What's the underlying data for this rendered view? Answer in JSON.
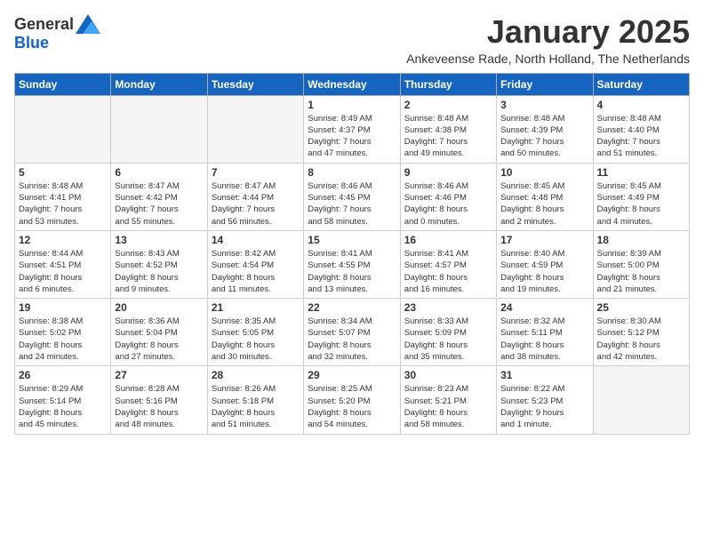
{
  "logo": {
    "general": "General",
    "blue": "Blue"
  },
  "header": {
    "month_year": "January 2025",
    "location": "Ankeveense Rade, North Holland, The Netherlands"
  },
  "weekdays": [
    "Sunday",
    "Monday",
    "Tuesday",
    "Wednesday",
    "Thursday",
    "Friday",
    "Saturday"
  ],
  "weeks": [
    [
      {
        "day": "",
        "info": ""
      },
      {
        "day": "",
        "info": ""
      },
      {
        "day": "",
        "info": ""
      },
      {
        "day": "1",
        "info": "Sunrise: 8:49 AM\nSunset: 4:37 PM\nDaylight: 7 hours\nand 47 minutes."
      },
      {
        "day": "2",
        "info": "Sunrise: 8:48 AM\nSunset: 4:38 PM\nDaylight: 7 hours\nand 49 minutes."
      },
      {
        "day": "3",
        "info": "Sunrise: 8:48 AM\nSunset: 4:39 PM\nDaylight: 7 hours\nand 50 minutes."
      },
      {
        "day": "4",
        "info": "Sunrise: 8:48 AM\nSunset: 4:40 PM\nDaylight: 7 hours\nand 51 minutes."
      }
    ],
    [
      {
        "day": "5",
        "info": "Sunrise: 8:48 AM\nSunset: 4:41 PM\nDaylight: 7 hours\nand 53 minutes."
      },
      {
        "day": "6",
        "info": "Sunrise: 8:47 AM\nSunset: 4:42 PM\nDaylight: 7 hours\nand 55 minutes."
      },
      {
        "day": "7",
        "info": "Sunrise: 8:47 AM\nSunset: 4:44 PM\nDaylight: 7 hours\nand 56 minutes."
      },
      {
        "day": "8",
        "info": "Sunrise: 8:46 AM\nSunset: 4:45 PM\nDaylight: 7 hours\nand 58 minutes."
      },
      {
        "day": "9",
        "info": "Sunrise: 8:46 AM\nSunset: 4:46 PM\nDaylight: 8 hours\nand 0 minutes."
      },
      {
        "day": "10",
        "info": "Sunrise: 8:45 AM\nSunset: 4:48 PM\nDaylight: 8 hours\nand 2 minutes."
      },
      {
        "day": "11",
        "info": "Sunrise: 8:45 AM\nSunset: 4:49 PM\nDaylight: 8 hours\nand 4 minutes."
      }
    ],
    [
      {
        "day": "12",
        "info": "Sunrise: 8:44 AM\nSunset: 4:51 PM\nDaylight: 8 hours\nand 6 minutes."
      },
      {
        "day": "13",
        "info": "Sunrise: 8:43 AM\nSunset: 4:52 PM\nDaylight: 8 hours\nand 9 minutes."
      },
      {
        "day": "14",
        "info": "Sunrise: 8:42 AM\nSunset: 4:54 PM\nDaylight: 8 hours\nand 11 minutes."
      },
      {
        "day": "15",
        "info": "Sunrise: 8:41 AM\nSunset: 4:55 PM\nDaylight: 8 hours\nand 13 minutes."
      },
      {
        "day": "16",
        "info": "Sunrise: 8:41 AM\nSunset: 4:57 PM\nDaylight: 8 hours\nand 16 minutes."
      },
      {
        "day": "17",
        "info": "Sunrise: 8:40 AM\nSunset: 4:59 PM\nDaylight: 8 hours\nand 19 minutes."
      },
      {
        "day": "18",
        "info": "Sunrise: 8:39 AM\nSunset: 5:00 PM\nDaylight: 8 hours\nand 21 minutes."
      }
    ],
    [
      {
        "day": "19",
        "info": "Sunrise: 8:38 AM\nSunset: 5:02 PM\nDaylight: 8 hours\nand 24 minutes."
      },
      {
        "day": "20",
        "info": "Sunrise: 8:36 AM\nSunset: 5:04 PM\nDaylight: 8 hours\nand 27 minutes."
      },
      {
        "day": "21",
        "info": "Sunrise: 8:35 AM\nSunset: 5:05 PM\nDaylight: 8 hours\nand 30 minutes."
      },
      {
        "day": "22",
        "info": "Sunrise: 8:34 AM\nSunset: 5:07 PM\nDaylight: 8 hours\nand 32 minutes."
      },
      {
        "day": "23",
        "info": "Sunrise: 8:33 AM\nSunset: 5:09 PM\nDaylight: 8 hours\nand 35 minutes."
      },
      {
        "day": "24",
        "info": "Sunrise: 8:32 AM\nSunset: 5:11 PM\nDaylight: 8 hours\nand 38 minutes."
      },
      {
        "day": "25",
        "info": "Sunrise: 8:30 AM\nSunset: 5:12 PM\nDaylight: 8 hours\nand 42 minutes."
      }
    ],
    [
      {
        "day": "26",
        "info": "Sunrise: 8:29 AM\nSunset: 5:14 PM\nDaylight: 8 hours\nand 45 minutes."
      },
      {
        "day": "27",
        "info": "Sunrise: 8:28 AM\nSunset: 5:16 PM\nDaylight: 8 hours\nand 48 minutes."
      },
      {
        "day": "28",
        "info": "Sunrise: 8:26 AM\nSunset: 5:18 PM\nDaylight: 8 hours\nand 51 minutes."
      },
      {
        "day": "29",
        "info": "Sunrise: 8:25 AM\nSunset: 5:20 PM\nDaylight: 8 hours\nand 54 minutes."
      },
      {
        "day": "30",
        "info": "Sunrise: 8:23 AM\nSunset: 5:21 PM\nDaylight: 8 hours\nand 58 minutes."
      },
      {
        "day": "31",
        "info": "Sunrise: 8:22 AM\nSunset: 5:23 PM\nDaylight: 9 hours\nand 1 minute."
      },
      {
        "day": "",
        "info": ""
      }
    ]
  ]
}
